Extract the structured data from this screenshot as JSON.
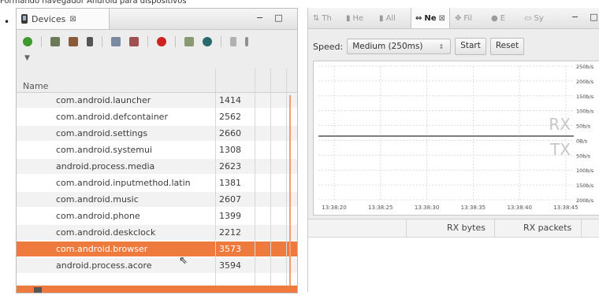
{
  "clipped_top_text": "Formando navegador Android para dispositivos",
  "devices_view": {
    "tab_title": "Devices",
    "tab_close": "⊠",
    "window_buttons": [
      "−",
      "□"
    ],
    "column_name": "Name",
    "processes": [
      {
        "name": "com.android.launcher",
        "pid": "1414"
      },
      {
        "name": "com.android.defcontainer",
        "pid": "2562"
      },
      {
        "name": "com.android.settings",
        "pid": "2660"
      },
      {
        "name": "com.android.systemui",
        "pid": "1308"
      },
      {
        "name": "android.process.media",
        "pid": "2623"
      },
      {
        "name": "com.android.inputmethod.latin",
        "pid": "1381"
      },
      {
        "name": "com.android.music",
        "pid": "2607"
      },
      {
        "name": "com.android.phone",
        "pid": "1399"
      },
      {
        "name": "com.android.deskclock",
        "pid": "2212"
      },
      {
        "name": "com.android.browser",
        "pid": "3573"
      },
      {
        "name": "android.process.acore",
        "pid": "3594"
      }
    ],
    "selected_index": 9
  },
  "network_view": {
    "tabs": [
      {
        "label": "Th",
        "icon": "threads-icon"
      },
      {
        "label": "He",
        "icon": "heap-icon"
      },
      {
        "label": "All",
        "icon": "allocation-icon"
      },
      {
        "label": "Ne",
        "icon": "network-icon",
        "active": true
      },
      {
        "label": "Fil",
        "icon": "file-explorer-icon"
      },
      {
        "label": "E",
        "icon": "emulator-icon"
      },
      {
        "label": "Sy",
        "icon": "sysinfo-icon"
      }
    ],
    "speed_label": "Speed:",
    "speed_value": "Medium (250ms)",
    "start_label": "Start",
    "reset_label": "Reset",
    "rx_label": "RX",
    "tx_label": "TX",
    "col_rx_bytes": "RX bytes",
    "col_rx_packets": "RX packets",
    "window_buttons": [
      "−",
      "□"
    ]
  },
  "chart_data": {
    "type": "line",
    "y_tick_labels": [
      "250b/s",
      "200b/s",
      "150b/s",
      "100b/s",
      "50b/s",
      "0B/s",
      "50b/s",
      "100b/s",
      "150b/s",
      "200b/s"
    ],
    "x_tick_labels": [
      "13:38:20",
      "13:38:25",
      "13:38:30",
      "13:38:35",
      "13:38:40",
      "13:38:45"
    ],
    "series": [
      {
        "name": "RX",
        "values": [
          0,
          0,
          0,
          0,
          0,
          0
        ]
      },
      {
        "name": "TX",
        "values": [
          0,
          0,
          0,
          0,
          0,
          0
        ]
      }
    ],
    "grid": true,
    "ylim_rx": [
      0,
      250
    ],
    "ylim_tx": [
      0,
      200
    ],
    "colors": {
      "line": "#6b6b6b",
      "grid": "#dcdcdc",
      "label": "#c7c7c7"
    }
  }
}
